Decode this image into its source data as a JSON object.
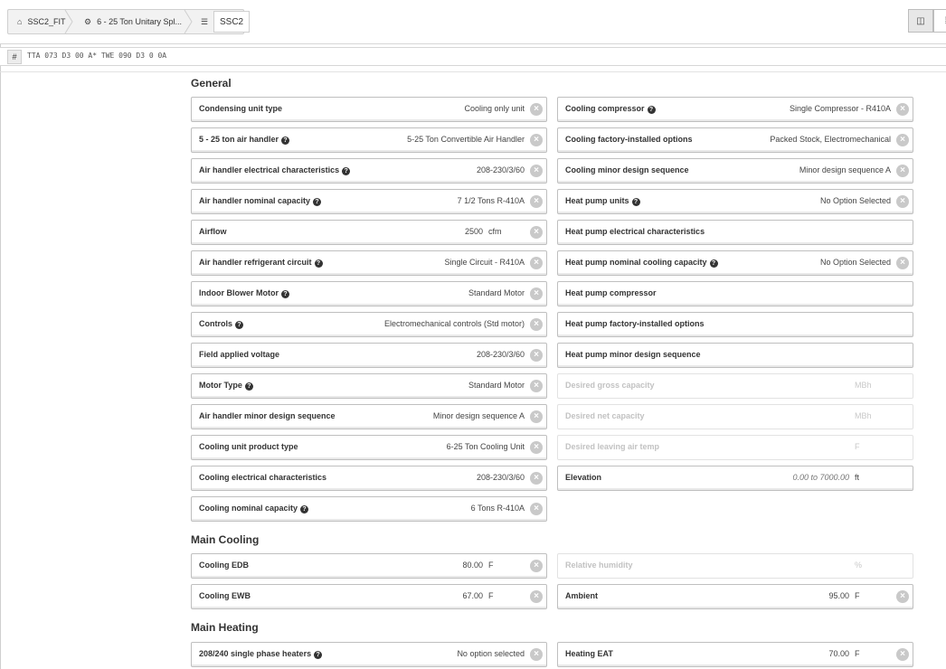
{
  "breadcrumb": {
    "items": [
      {
        "icon": "home-icon",
        "label": "SSC2_FIT"
      },
      {
        "icon": "gear-icon",
        "label": "6 - 25 Ton Unitary Spl..."
      },
      {
        "icon": "list-icon",
        "label": "SSC2"
      }
    ]
  },
  "toolbar": {
    "view_buttons": [
      "panel-view-icon",
      "grid-view-icon"
    ]
  },
  "code": {
    "hash": "#",
    "text": "TTA 073 D3 00 A* TWE 090 D3 0 0A"
  },
  "sections": {
    "general": "General",
    "main_cooling": "Main Cooling",
    "main_heating": "Main Heating"
  },
  "general_left": [
    {
      "label": "Condensing unit type",
      "help": false,
      "value": "Cooling only unit",
      "clear": true
    },
    {
      "label": "5 - 25 ton air handler",
      "help": true,
      "value": "5-25 Ton Convertible Air Handler",
      "clear": true
    },
    {
      "label": "Air handler electrical characteristics",
      "help": true,
      "value": "208-230/3/60",
      "clear": true
    },
    {
      "label": "Air handler nominal capacity",
      "help": true,
      "value": "7 1/2 Tons R-410A",
      "clear": true
    },
    {
      "label": "Airflow",
      "help": false,
      "value": "2500",
      "unit": "cfm",
      "clear": true
    },
    {
      "label": "Air handler refrigerant circuit",
      "help": true,
      "value": "Single Circuit - R410A",
      "clear": true
    },
    {
      "label": "Indoor Blower Motor",
      "help": true,
      "value": "Standard Motor",
      "clear": true
    },
    {
      "label": "Controls",
      "help": true,
      "value": "Electromechanical controls (Std motor)",
      "clear": true
    },
    {
      "label": "Field applied voltage",
      "help": false,
      "value": "208-230/3/60",
      "clear": true
    },
    {
      "label": "Motor Type",
      "help": true,
      "value": "Standard Motor",
      "clear": true
    },
    {
      "label": "Air handler minor design sequence",
      "help": false,
      "value": "Minor design sequence A",
      "clear": true
    },
    {
      "label": "Cooling unit product type",
      "help": false,
      "value": "6-25 Ton Cooling Unit",
      "clear": true
    },
    {
      "label": "Cooling electrical characteristics",
      "help": false,
      "value": "208-230/3/60",
      "clear": true
    },
    {
      "label": "Cooling nominal capacity",
      "help": true,
      "value": "6 Tons R-410A",
      "clear": true
    }
  ],
  "general_right": [
    {
      "label": "Cooling compressor",
      "help": true,
      "value": "Single Compressor - R410A",
      "clear": true
    },
    {
      "label": "Cooling factory-installed options",
      "help": false,
      "value": "Packed Stock, Electromechanical",
      "clear": true
    },
    {
      "label": "Cooling minor design sequence",
      "help": false,
      "value": "Minor design sequence A",
      "clear": true
    },
    {
      "label": "Heat pump units",
      "help": true,
      "value": "No Option Selected",
      "clear": true
    },
    {
      "label": "Heat pump electrical characteristics",
      "help": false,
      "value": "",
      "clear": false
    },
    {
      "label": "Heat pump nominal cooling capacity",
      "help": true,
      "value": "No Option Selected",
      "clear": true
    },
    {
      "label": "Heat pump compressor",
      "help": false,
      "value": "",
      "clear": false
    },
    {
      "label": "Heat pump factory-installed options",
      "help": false,
      "value": "",
      "clear": false
    },
    {
      "label": "Heat pump minor design sequence",
      "help": false,
      "value": "",
      "clear": false
    },
    {
      "label": "Desired gross capacity",
      "help": false,
      "value": "",
      "unit": "MBh",
      "disabled": true,
      "clear": false
    },
    {
      "label": "Desired net capacity",
      "help": false,
      "value": "",
      "unit": "MBh",
      "disabled": true,
      "clear": false
    },
    {
      "label": "Desired leaving air temp",
      "help": false,
      "value": "",
      "unit": "F",
      "disabled": true,
      "clear": false
    },
    {
      "label": "Elevation",
      "help": false,
      "value": "0.00 to 7000.00",
      "unit": "ft",
      "italic": true,
      "clear": false
    }
  ],
  "cooling_left": [
    {
      "label": "Cooling EDB",
      "help": false,
      "value": "80.00",
      "unit": "F",
      "clear": true
    },
    {
      "label": "Cooling EWB",
      "help": false,
      "value": "67.00",
      "unit": "F",
      "clear": true
    }
  ],
  "cooling_right": [
    {
      "label": "Relative humidity",
      "help": false,
      "value": "",
      "unit": "%",
      "disabled": true,
      "clear": false
    },
    {
      "label": "Ambient",
      "help": false,
      "value": "95.00",
      "unit": "F",
      "clear": true
    }
  ],
  "heating_left": [
    {
      "label": "208/240 single phase heaters",
      "help": true,
      "value": "No option selected",
      "clear": true
    }
  ],
  "heating_right": [
    {
      "label": "Heating EAT",
      "help": false,
      "value": "70.00",
      "unit": "F",
      "clear": true
    }
  ]
}
